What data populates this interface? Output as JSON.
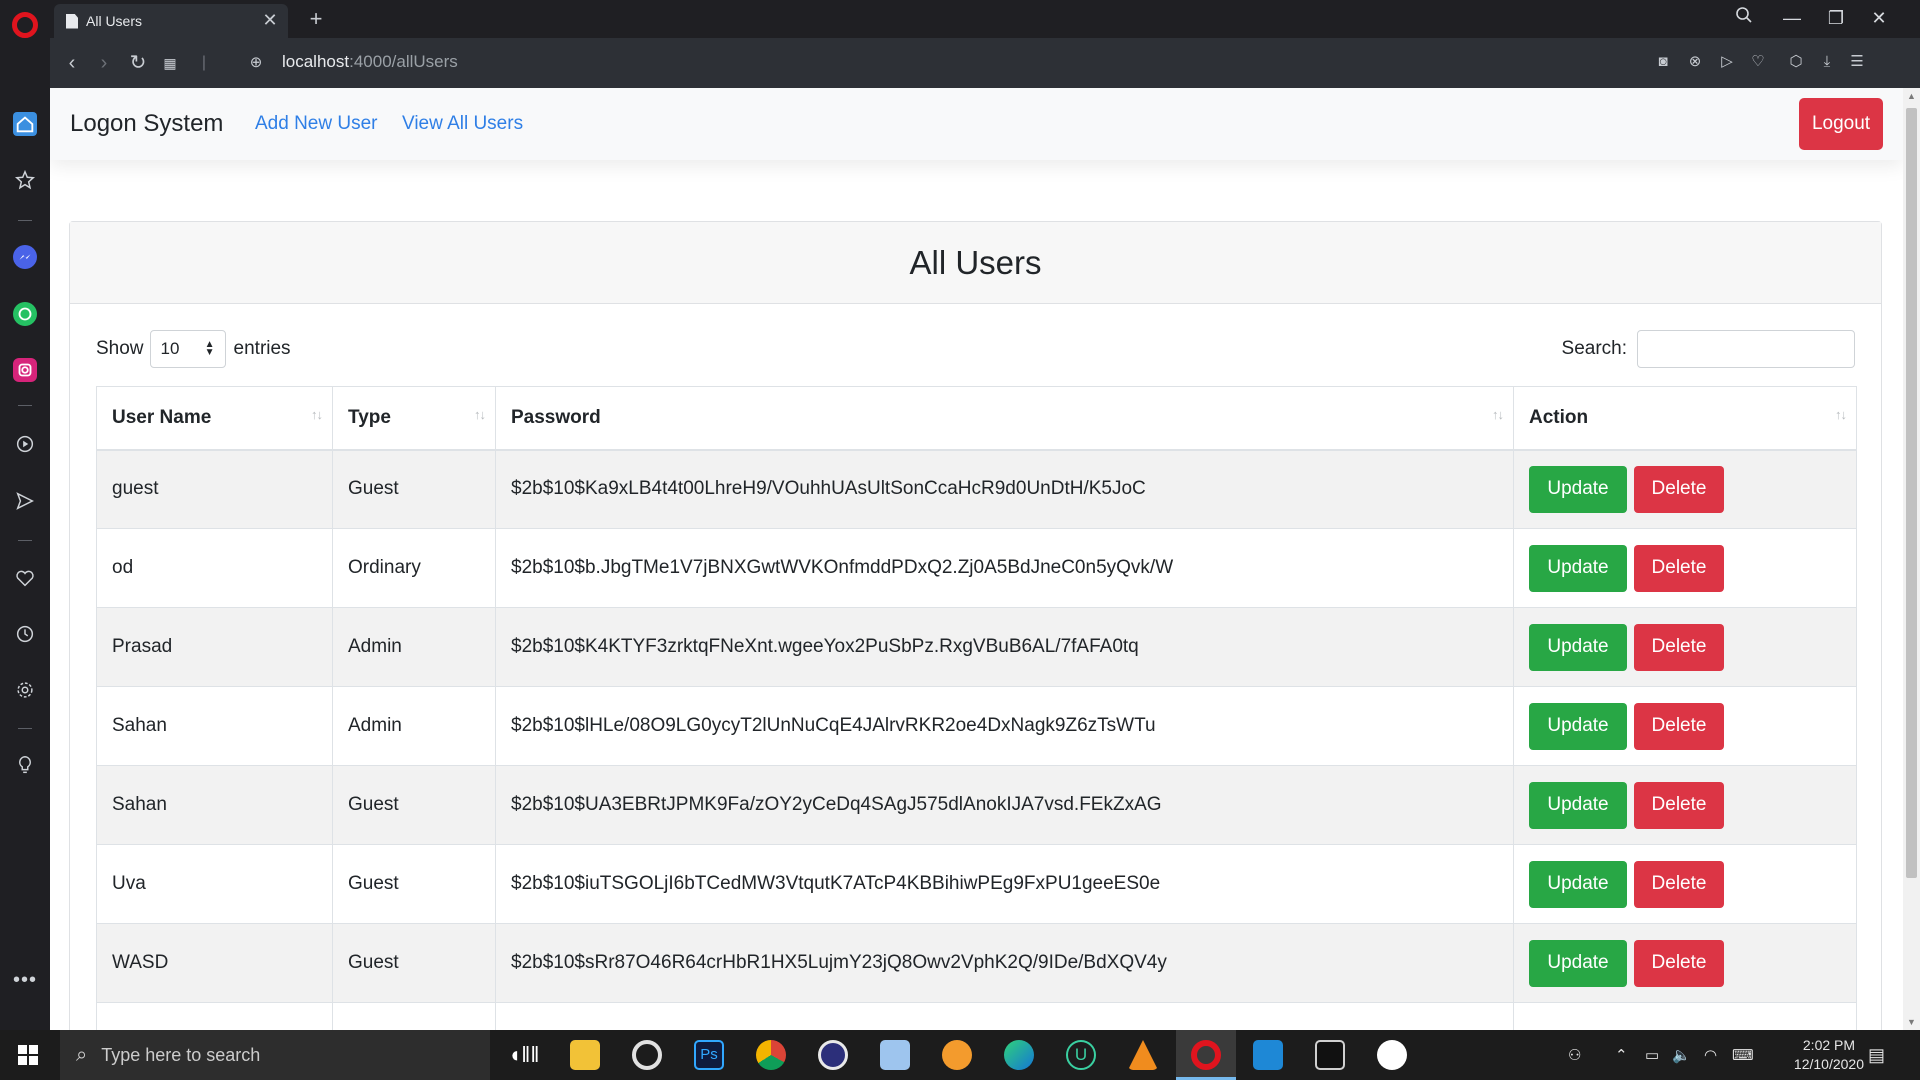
{
  "browser": {
    "tab_title": "All Users",
    "url_host": "localhost",
    "url_path": ":4000/allUsers"
  },
  "navbar": {
    "brand": "Logon System",
    "links": [
      "Add New User",
      "View All Users"
    ],
    "logout_label": "Logout"
  },
  "page": {
    "title": "All Users",
    "show_label": "Show",
    "entries_value": "10",
    "entries_label": "entries",
    "search_label": "Search:"
  },
  "table": {
    "headers": [
      "User Name",
      "Type",
      "Password",
      "Action"
    ],
    "rows": [
      {
        "name": "guest",
        "type": "Guest",
        "password": "$2b$10$Ka9xLB4t4t00LhreH9/VOuhhUAsUltSonCcaHcR9d0UnDtH/K5JoC"
      },
      {
        "name": "od",
        "type": "Ordinary",
        "password": "$2b$10$b.JbgTMe1V7jBNXGwtWVKOnfmddPDxQ2.Zj0A5BdJneC0n5yQvk/W"
      },
      {
        "name": "Prasad",
        "type": "Admin",
        "password": "$2b$10$K4KTYF3zrktqFNeXnt.wgeeYox2PuSbPz.RxgVBuB6AL/7fAFA0tq"
      },
      {
        "name": "Sahan",
        "type": "Admin",
        "password": "$2b$10$lHLe/08O9LG0ycyT2lUnNuCqE4JAlrvRKR2oe4DxNagk9Z6zTsWTu"
      },
      {
        "name": "Sahan",
        "type": "Guest",
        "password": "$2b$10$UA3EBRtJPMK9Fa/zOY2yCeDq4SAgJ575dlAnokIJA7vsd.FEkZxAG"
      },
      {
        "name": "Uva",
        "type": "Guest",
        "password": "$2b$10$iuTSGOLjI6bTCedMW3VtqutK7ATcP4KBBihiwPEg9FxPU1geeES0e"
      },
      {
        "name": "WASD",
        "type": "Guest",
        "password": "$2b$10$sRr87O46R64crHbR1HX5LujmY23jQ8Owv2VphK2Q/9IDe/BdXQV4y"
      }
    ],
    "update_label": "Update",
    "delete_label": "Delete"
  },
  "taskbar": {
    "search_placeholder": "Type here to search",
    "time": "2:02 PM",
    "date": "12/10/2020"
  },
  "colors": {
    "primary_link": "#2f7fe6",
    "success": "#28a745",
    "danger": "#dc3545"
  }
}
